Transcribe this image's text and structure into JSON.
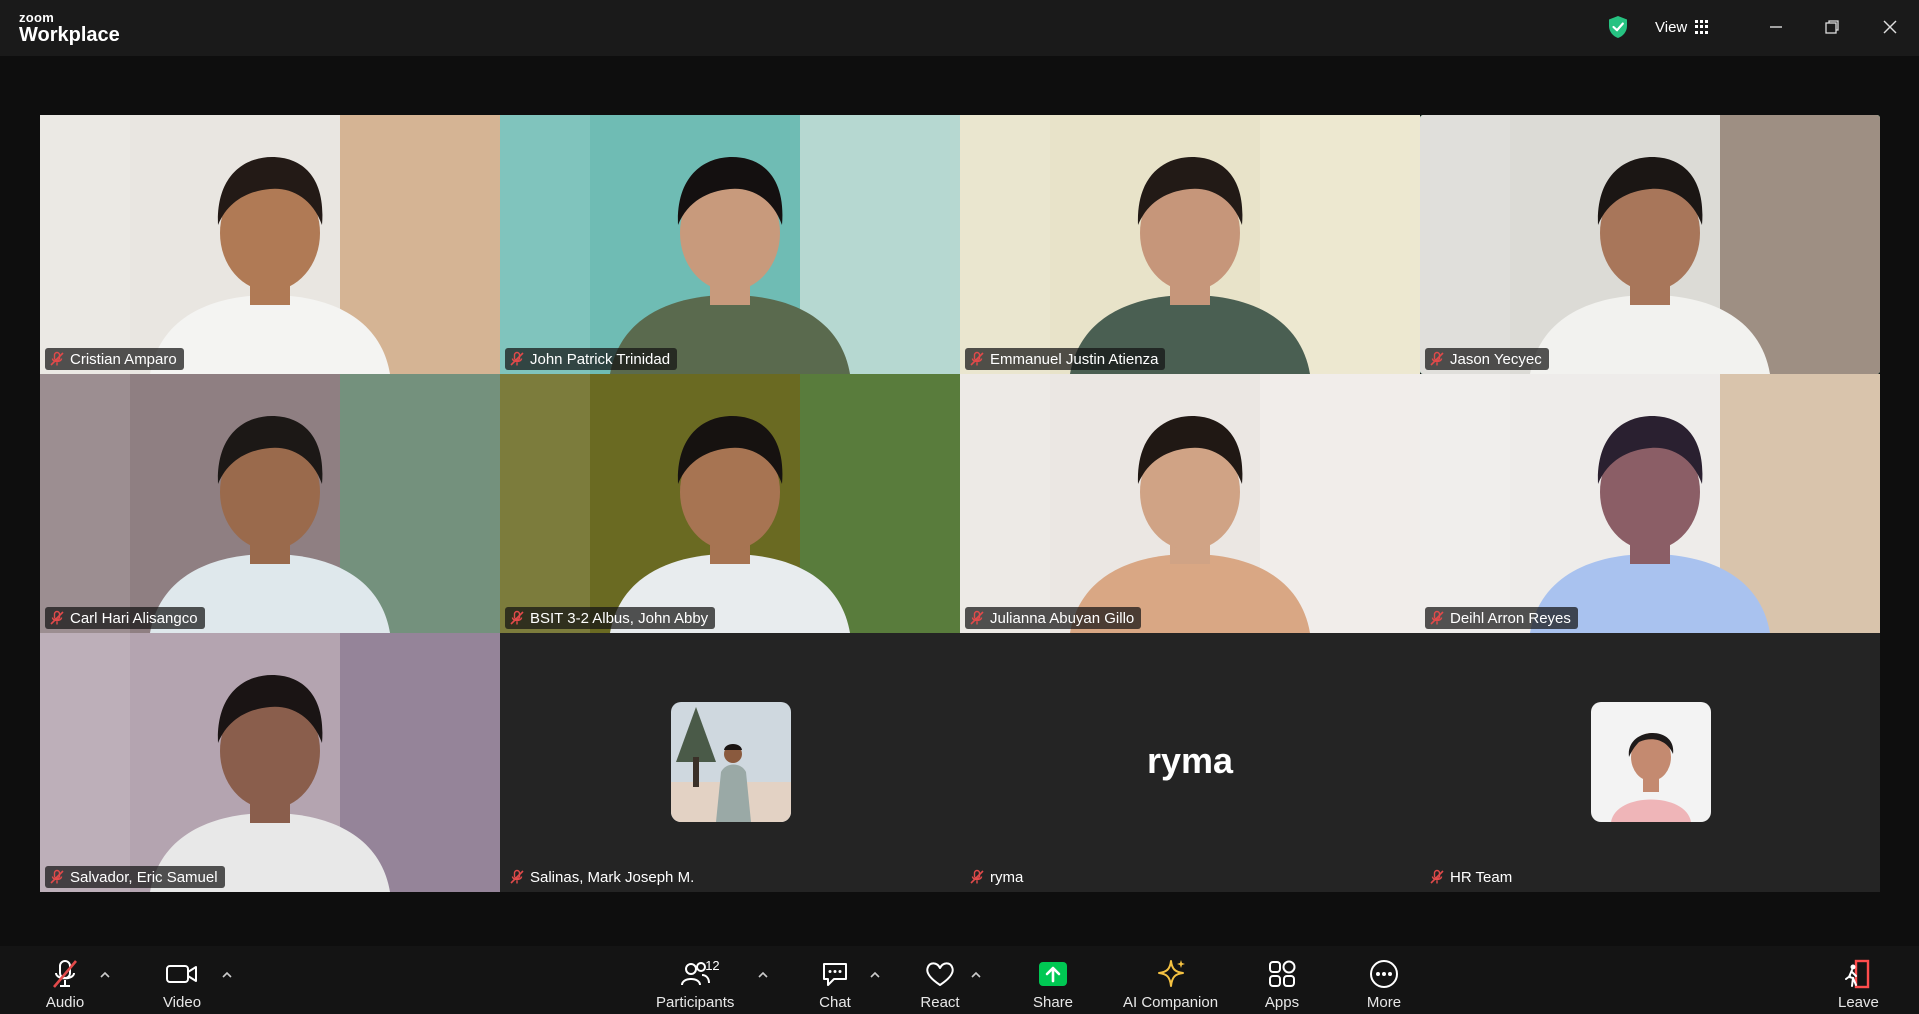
{
  "window": {
    "brand_line1": "zoom",
    "brand_line2": "Workplace",
    "view_label": "View"
  },
  "participants": [
    {
      "name": "Cristian Amparo",
      "muted": true,
      "video": true,
      "scene": "wood"
    },
    {
      "name": "John Patrick Trinidad",
      "muted": true,
      "video": true,
      "scene": "teal"
    },
    {
      "name": "Emmanuel Justin Atienza",
      "muted": true,
      "video": true,
      "scene": "beige"
    },
    {
      "name": "Jason Yecyec",
      "muted": true,
      "video": true,
      "scene": "room",
      "active_speaker": true
    },
    {
      "name": "Carl Hari Alisangco",
      "muted": true,
      "video": true,
      "scene": "curtain"
    },
    {
      "name": "BSIT 3-2 Albus, John Abby",
      "muted": true,
      "video": true,
      "scene": "green"
    },
    {
      "name": "Julianna Abuyan Gillo",
      "muted": true,
      "video": true,
      "scene": "white"
    },
    {
      "name": "Deihl Arron Reyes",
      "muted": true,
      "video": true,
      "scene": "shelf"
    },
    {
      "name": "Salvador, Eric Samuel",
      "muted": true,
      "video": true,
      "scene": "purple"
    },
    {
      "name": "Salinas, Mark Joseph M.",
      "muted": true,
      "video": false,
      "avatar": "photo-tree"
    },
    {
      "name": "ryma",
      "muted": true,
      "video": false,
      "display": "ryma"
    },
    {
      "name": "HR Team",
      "muted": true,
      "video": false,
      "avatar": "photo-pink"
    }
  ],
  "toolbar": {
    "audio": "Audio",
    "video": "Video",
    "participants": "Participants",
    "participant_count": "12",
    "chat": "Chat",
    "react": "React",
    "share": "Share",
    "ai_companion": "AI Companion",
    "apps": "Apps",
    "more": "More",
    "leave": "Leave"
  },
  "colors": {
    "active_speaker": "#2ee08a",
    "share": "#00c853",
    "muted_red": "#e24a4a",
    "ai_star": "#f5c242",
    "leave": "#ff4d4d"
  }
}
